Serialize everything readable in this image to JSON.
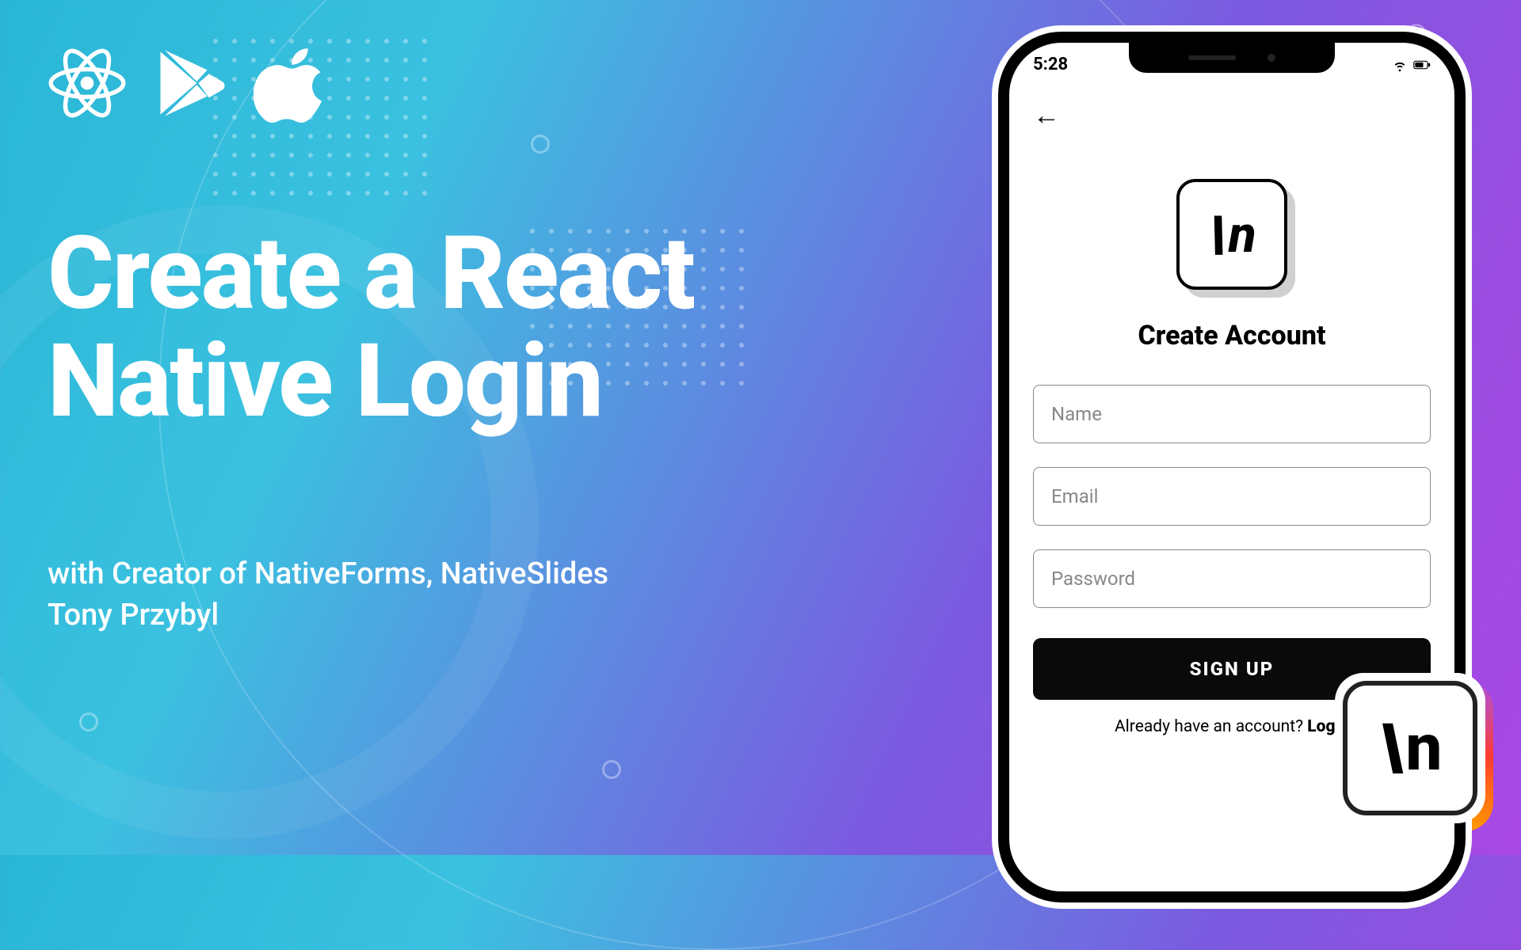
{
  "headline": "Create a React Native Login",
  "subhead_line1": "with Creator of NativeForms, NativeSlides",
  "subhead_line2": "Tony Przybyl",
  "icons": {
    "react": "react-icon",
    "play": "play-store-icon",
    "apple": "apple-icon"
  },
  "phone": {
    "status_time": "5:28",
    "screen_title": "Create Account",
    "fields": {
      "name": "Name",
      "email": "Email",
      "password": "Password"
    },
    "signup_button": "SIGN UP",
    "already_text": "Already have an account? ",
    "already_login": "Login",
    "logo_text_slash": "\\",
    "logo_text_n": "n"
  },
  "badge": {
    "slash": "\\",
    "n": "n"
  }
}
